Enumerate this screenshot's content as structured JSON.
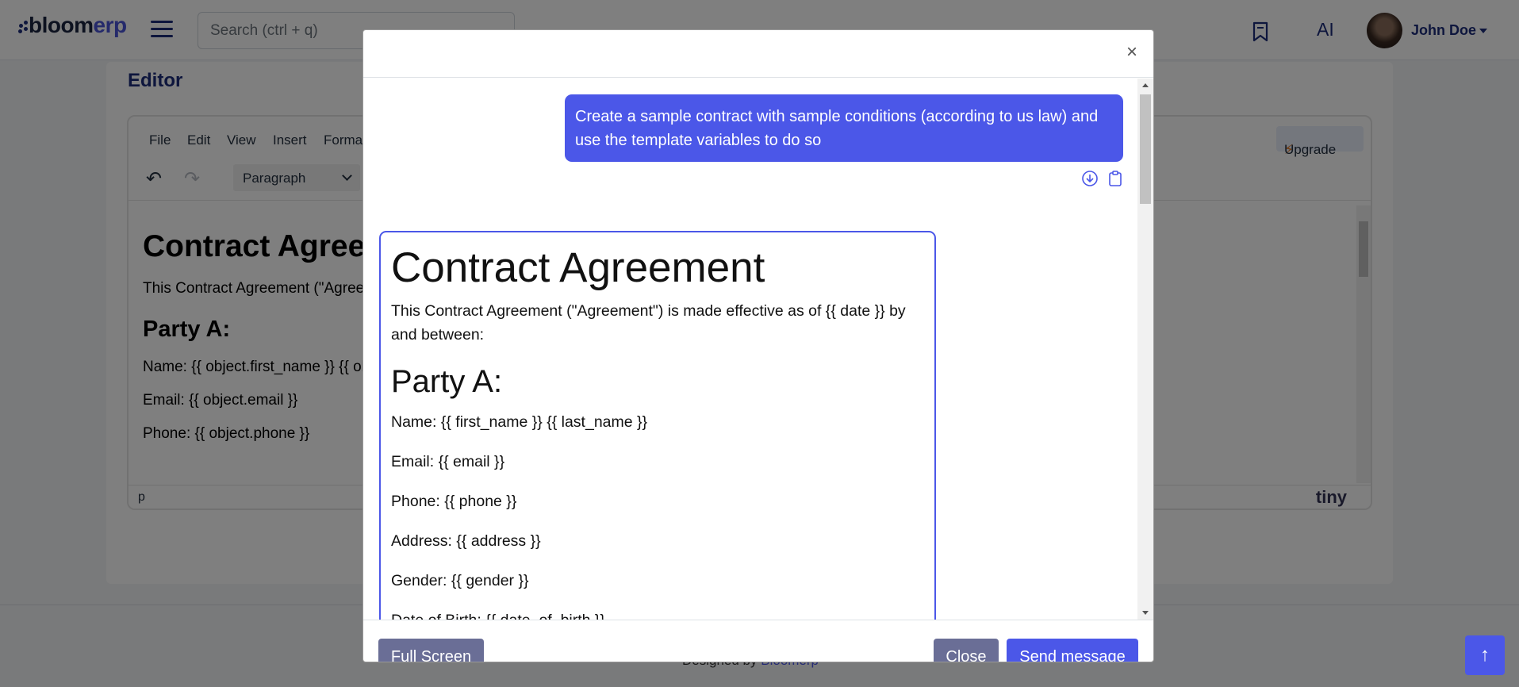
{
  "app": {
    "logo_part1": "bloom",
    "logo_part2": "erp",
    "search_placeholder": "Search (ctrl + q)",
    "ai_label": "AI",
    "user_name": "John Doe"
  },
  "page": {
    "title": "Editor",
    "editor": {
      "menu": [
        "File",
        "Edit",
        "View",
        "Insert",
        "Format"
      ],
      "block_format": "Paragraph",
      "upgrade_label": "Upgrade",
      "status_path": "p",
      "brand": "tiny",
      "content": {
        "heading": "Contract Agreement",
        "intro": "This Contract Agreement (\"Agreement\") is made effective as of {{ date }} by and between:",
        "party_heading": "Party A:",
        "name_line": "Name: {{ object.first_name }} {{ object.last_name }}",
        "email_line": "Email: {{ object.email }}",
        "phone_line": "Phone: {{ object.phone }}"
      }
    },
    "footer": {
      "prefix": "Designed by",
      "link": "Bloomerp"
    }
  },
  "modal": {
    "user_message": "Create a sample contract with sample conditions (according to us law) and use the template variables to do so",
    "ai_response": {
      "heading": "Contract Agreement",
      "intro": "This Contract Agreement (\"Agreement\") is made effective as of {{ date }} by and between:",
      "party_heading": "Party A:",
      "fields": [
        "Name: {{ first_name }} {{ last_name }}",
        "Email: {{ email }}",
        "Phone: {{ phone }}",
        "Address: {{ address }}",
        "Gender: {{ gender }}",
        "Date of Birth: {{ date_of_birth }}"
      ]
    },
    "buttons": {
      "full_screen": "Full Screen",
      "close": "Close",
      "send": "Send message"
    }
  },
  "colors": {
    "primary": "#4b57e8",
    "secondary": "#6a6e96",
    "navy": "#1d2d7a"
  }
}
